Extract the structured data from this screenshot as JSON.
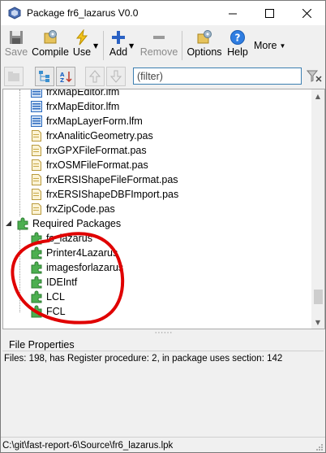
{
  "window": {
    "title": "Package fr6_lazarus V0.0"
  },
  "toolbar": {
    "save": "Save",
    "compile": "Compile",
    "use": "Use",
    "add": "Add",
    "remove": "Remove",
    "options": "Options",
    "help": "Help",
    "more": "More"
  },
  "filter": {
    "placeholder": "(filter)"
  },
  "tree": {
    "files": [
      "frxMapEditor.lfm",
      "frxMapEditor.lfm",
      "frxMapLayerForm.lfm",
      "frxAnaliticGeometry.pas",
      "frxGPXFileFormat.pas",
      "frxOSMFileFormat.pas",
      "frxERSIShapeFileFormat.pas",
      "frxERSIShapeDBFImport.pas",
      "frxZipCode.pas"
    ],
    "required_label": "Required Packages",
    "packages": [
      "fs_lazarus",
      "Printer4Lazarus",
      "imagesforlazarus",
      "IDEIntf",
      "LCL",
      "FCL"
    ]
  },
  "properties": {
    "title": "File Properties",
    "info": "Files: 198, has Register procedure: 2, in package uses section: 142"
  },
  "status": {
    "path": "C:\\git\\fast-report-6\\Source\\fr6_lazarus.lpk"
  },
  "colors": {
    "annotation": "#e00000",
    "accent": "#3c7fb1"
  }
}
